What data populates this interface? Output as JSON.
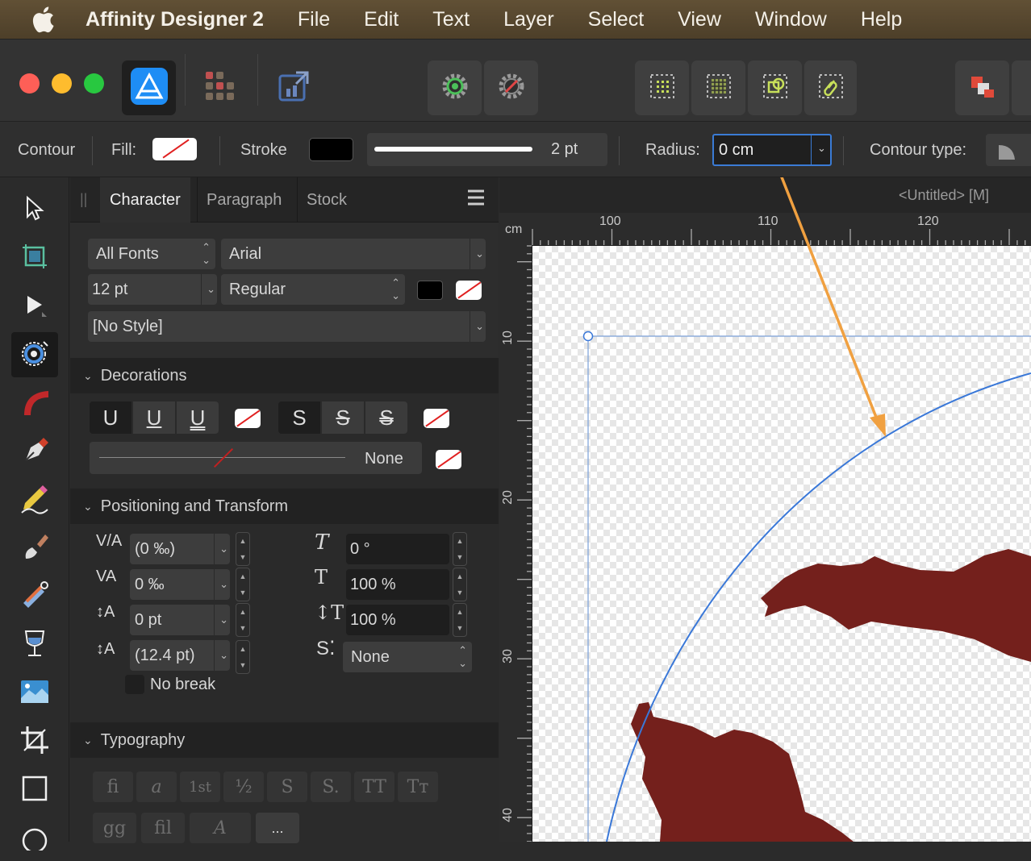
{
  "menubar": {
    "app_name": "Affinity Designer 2",
    "items": [
      "File",
      "Edit",
      "Text",
      "Layer",
      "Select",
      "View",
      "Window",
      "Help"
    ]
  },
  "context_toolbar": {
    "tool_name": "Contour",
    "fill_label": "Fill:",
    "stroke_label": "Stroke",
    "stroke_width": "2 pt",
    "radius_label": "Radius:",
    "radius_value": "0 cm",
    "contour_type_label": "Contour type:"
  },
  "panel": {
    "tabs": [
      "Character",
      "Paragraph",
      "Stock"
    ],
    "active_tab": "Character",
    "font_collection": "All Fonts",
    "font_family": "Arial",
    "font_size": "12 pt",
    "font_style": "Regular",
    "style": "[No Style]",
    "decorations": {
      "title": "Decorations",
      "underline_glyph": "U",
      "strike_glyph": "S",
      "line_style": "None"
    },
    "positioning": {
      "title": "Positioning and Transform",
      "tracking": "(0 ‰)",
      "kerning": "0 ‰",
      "baseline": "0 pt",
      "leading": "(12.4 pt)",
      "shear": "0 °",
      "vertical_scale": "100 %",
      "horizontal_scale": "100 %",
      "script": "None",
      "no_break": "No break"
    },
    "typography": {
      "title": "Typography",
      "glyphs": [
        "fi",
        "a",
        "1st",
        "½",
        "S",
        "S.",
        "TT",
        "Tт",
        "gg",
        "fil",
        "A",
        "..."
      ]
    }
  },
  "canvas": {
    "document_title": "<Untitled> [M]",
    "ruler_unit": "cm",
    "h_ticks": [
      "100",
      "110",
      "120"
    ],
    "v_ticks": [
      "10",
      "20",
      "30",
      "40"
    ]
  },
  "colors": {
    "accent": "#3a7bd5",
    "annotation_arrow": "#f0a040",
    "shape_fill": "#7a1c1a",
    "traffic_red": "#fe5f57",
    "traffic_yellow": "#febc2e",
    "traffic_green": "#28c840"
  },
  "icons": {
    "toolbar": [
      "apple-icon",
      "designer-persona-icon",
      "pixel-persona-icon",
      "export-persona-icon",
      "settings-icon",
      "snapping-icon",
      "grid-icon",
      "pixel-grid-icon",
      "transform-icon",
      "link-icon"
    ],
    "tools": [
      "move-tool-icon",
      "artboard-tool-icon",
      "node-tool-icon",
      "contour-tool-icon",
      "corner-tool-icon",
      "pen-tool-icon",
      "pencil-tool-icon",
      "brush-tool-icon",
      "fill-tool-icon",
      "transparency-tool-icon",
      "place-image-icon",
      "crop-tool-icon",
      "rectangle-tool-icon",
      "ellipse-tool-icon"
    ]
  }
}
